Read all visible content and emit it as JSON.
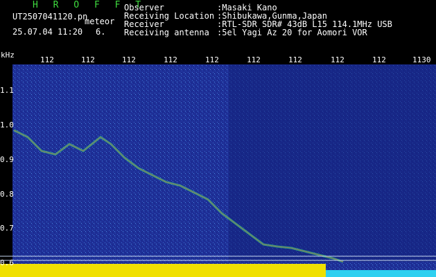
{
  "header": {
    "app_title": "H R O F F T",
    "filename": "UT2507041120.pn",
    "filename_suffix": "meteor",
    "datetime": "25.07.04 11:20",
    "counter": "6."
  },
  "info": [
    {
      "label": "Observer",
      "value": ":Masaki Kano"
    },
    {
      "label": "Receiving Location",
      "value": ":Shibukawa,Gunma,Japan"
    },
    {
      "label": "Receiver",
      "value": ":RTL-SDR SDR# 43dB L15 114.1MHz USB"
    },
    {
      "label": "Receiving antenna",
      "value": ":5el Yagi Az 20 for Aomori VOR"
    }
  ],
  "axes": {
    "unit": "kHz",
    "y_ticks": [
      "1.1",
      "1.0",
      "0.9",
      "0.8",
      "0.7",
      "0.6"
    ],
    "x_ticks": [
      "112",
      "112",
      "112",
      "112",
      "112",
      "112",
      "112",
      "112",
      "112",
      "1130"
    ]
  },
  "colors": {
    "background": "#1a2a8c",
    "trace": "#f0e000",
    "cyan_band": "#2fd0f0"
  }
}
